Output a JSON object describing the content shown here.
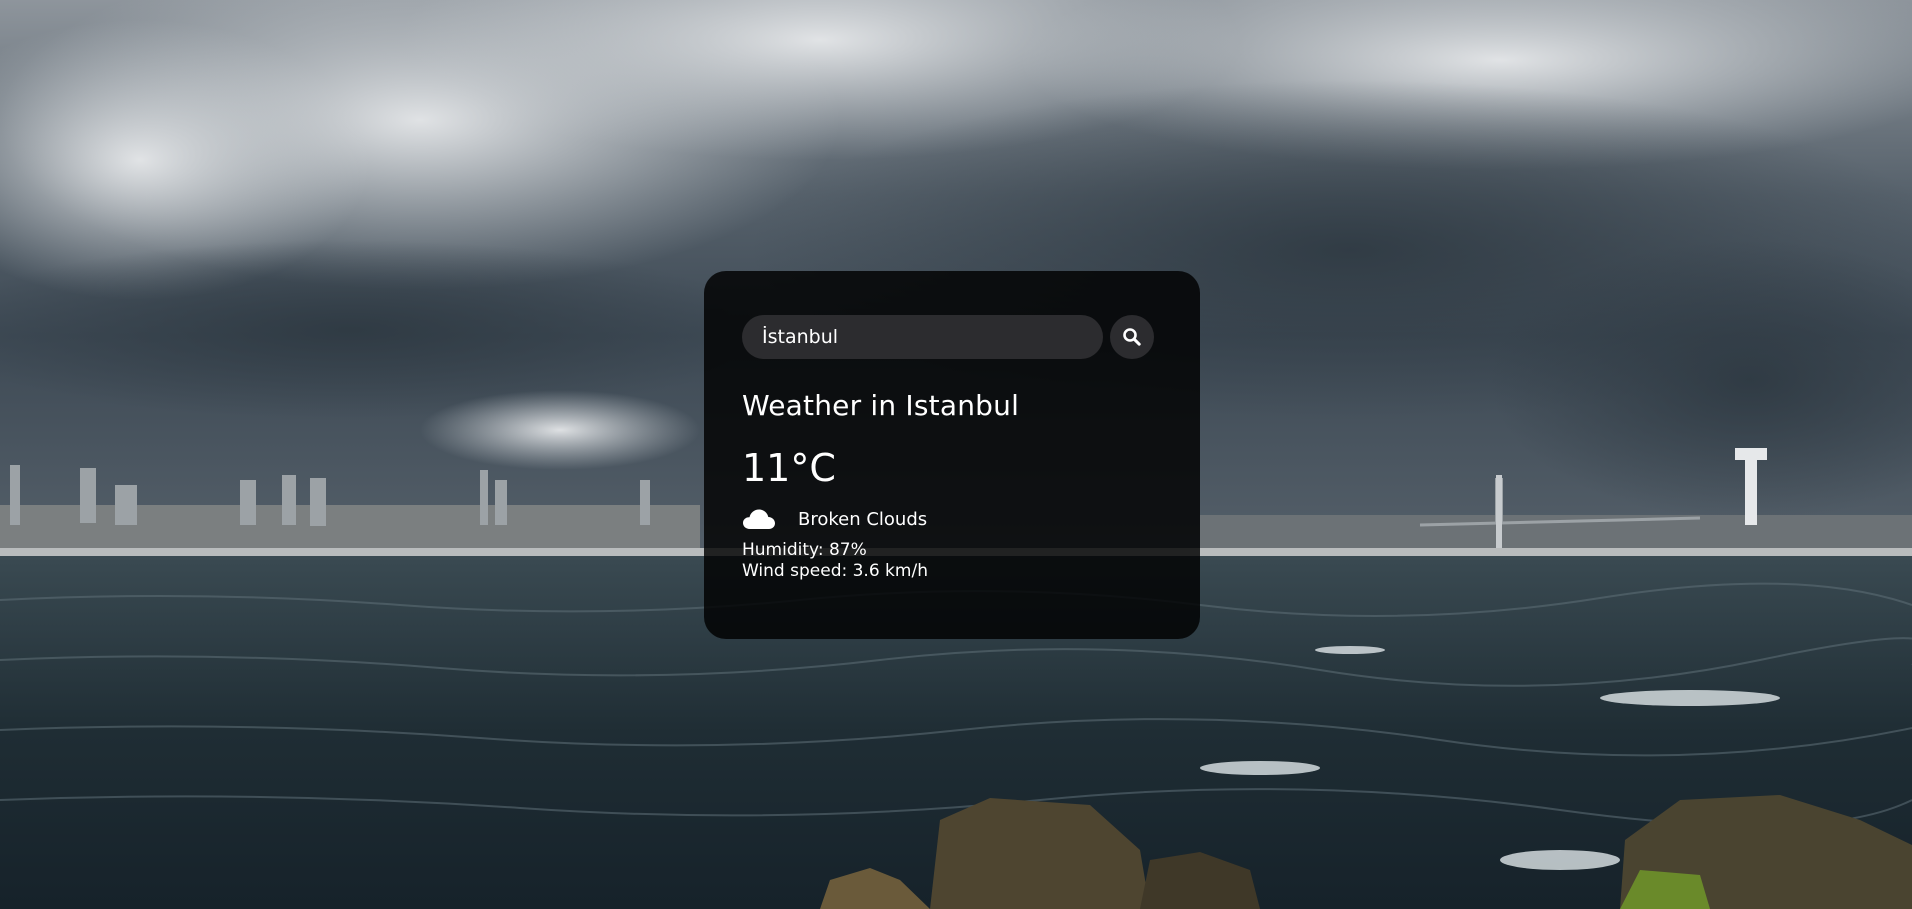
{
  "search": {
    "value": "İstanbul",
    "placeholder": "Search"
  },
  "weather": {
    "title": "Weather in Istanbul",
    "temperature": "11°C",
    "description": "Broken Clouds",
    "humidity": "Humidity: 87%",
    "wind": "Wind speed: 3.6 km/h"
  },
  "icons": {
    "search": "search-icon",
    "condition": "cloud-icon"
  },
  "colors": {
    "card_background": "#000000",
    "input_background": "#2c2c2f",
    "text": "#ffffff"
  }
}
